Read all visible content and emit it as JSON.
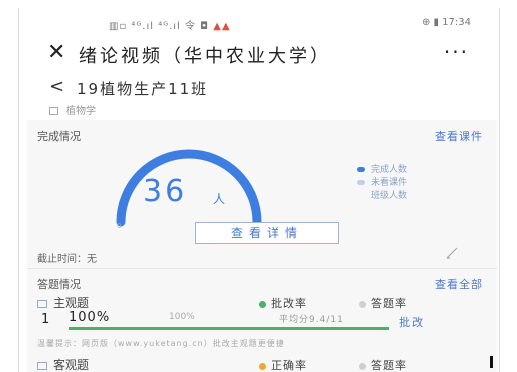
{
  "status_bar": {
    "left_icons": "▥▫ ⁴ᴳ.ıl ⁴ᴳ.ıl 令 ◘",
    "left_red": "▲▲",
    "right_text": "⊕ ▮ 17:34"
  },
  "titlebar": {
    "close_glyph": "✕",
    "title": "绪论视频（华中农业大学）",
    "more_glyph": "···"
  },
  "class_header": {
    "back_glyph": "<",
    "class_name": "19植物生产11班"
  },
  "subject": "植物学",
  "completion": {
    "heading": "完成情况",
    "view_link": "查看课件",
    "count": "36",
    "unit": "人",
    "scale_min": "0",
    "scale_max": "36",
    "completed_fraction": 1.0,
    "legend": [
      {
        "label": "完成人数",
        "color": "#3d7ee0"
      },
      {
        "label": "未看课件",
        "color": "#bcd0ee"
      },
      {
        "label": "班级人数",
        "color": ""
      }
    ],
    "detail_button": "查看详情",
    "deadline_label": "截止时间：",
    "deadline_value": "无"
  },
  "answers": {
    "heading": "答题情况",
    "view_all": "查看全部",
    "objective": {
      "label": "主观题",
      "legend": [
        {
          "label": "批改率",
          "color": "#4ab06a"
        },
        {
          "label": "答题率",
          "color": "#cfcfcf"
        }
      ],
      "index": "1",
      "percent": "100%",
      "percent_secondary": "100%",
      "average": "平均分9.4/11",
      "action": "批改",
      "progress_fraction": 1.0
    },
    "note": "温馨提示：网页版（www.yuketang.cn）批改主观题更便捷",
    "choice": {
      "label": "客观题",
      "legend": [
        {
          "label": "正确率",
          "color": "#f2a531"
        },
        {
          "label": "答题率",
          "color": "#cfcfcf"
        }
      ]
    }
  }
}
